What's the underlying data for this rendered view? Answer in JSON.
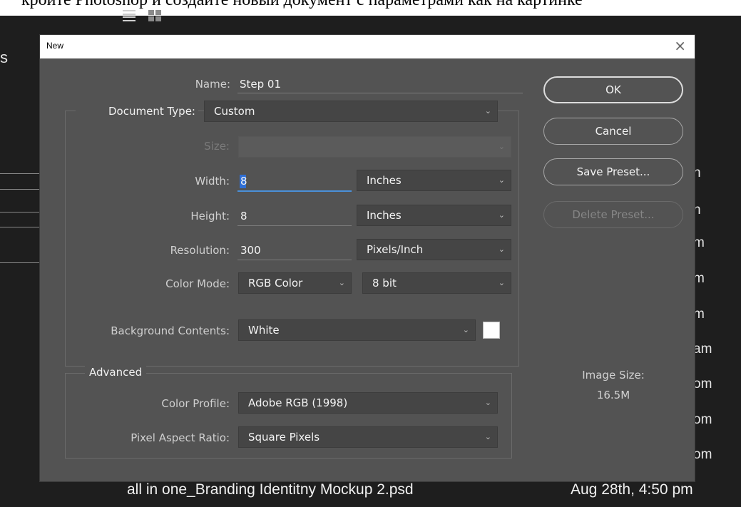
{
  "caption_text": "кройте Photoshop и создайте новый документ с параметрами как на картинке",
  "background": {
    "side_text": "s",
    "right_items": [
      "n",
      "n",
      "m",
      "m",
      "m",
      "am",
      "om",
      "om",
      "om"
    ],
    "bottom_file": "all in one_Branding Identitny Mockup 2.psd",
    "bottom_date": "Aug 28th, 4:50 pm"
  },
  "dialog": {
    "title": "New",
    "close_glyph": "×",
    "name_label": "Name:",
    "name_value": "Step 01",
    "document_type_label": "Document Type:",
    "document_type_value": "Custom",
    "size_label": "Size:",
    "size_value": "",
    "width_label": "Width:",
    "width_value": "8",
    "width_unit": "Inches",
    "height_label": "Height:",
    "height_value": "8",
    "height_unit": "Inches",
    "resolution_label": "Resolution:",
    "resolution_value": "300",
    "resolution_unit": "Pixels/Inch",
    "color_mode_label": "Color Mode:",
    "color_mode_value": "RGB Color",
    "bit_depth_value": "8 bit",
    "background_label": "Background Contents:",
    "background_value": "White",
    "background_swatch_color": "#ffffff",
    "advanced_label": "Advanced",
    "color_profile_label": "Color Profile:",
    "color_profile_value": "Adobe RGB (1998)",
    "pixel_aspect_label": "Pixel Aspect Ratio:",
    "pixel_aspect_value": "Square Pixels",
    "image_size_label": "Image Size:",
    "image_size_value": "16.5M"
  },
  "buttons": {
    "ok": "OK",
    "cancel": "Cancel",
    "save_preset": "Save Preset...",
    "delete_preset": "Delete Preset..."
  },
  "icons": {
    "dropdown": "chevron-down-icon",
    "list_view": "list-view-icon",
    "grid_view": "grid-view-icon"
  },
  "colors": {
    "dialog_bg": "#535353",
    "field_bg": "#454545",
    "focus_underline": "#4a90d9"
  }
}
